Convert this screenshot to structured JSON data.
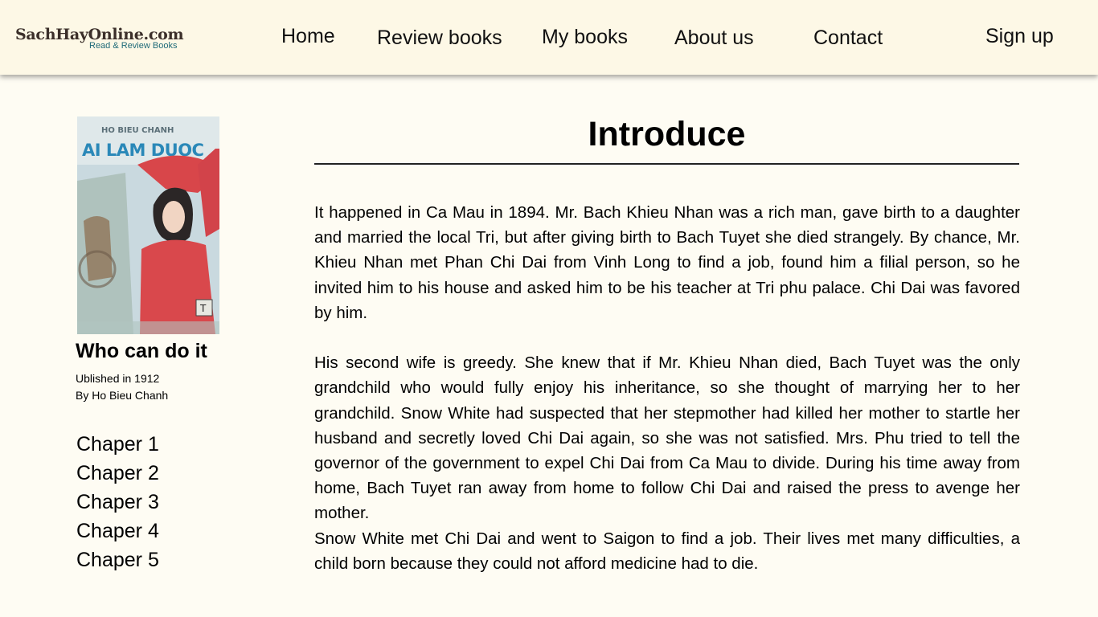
{
  "header": {
    "logo_main": "SachHayOnline.com",
    "logo_sub": "Read & Review Books",
    "nav": {
      "home": "Home",
      "review_books": "Review books",
      "my_books": "My books",
      "about_us": "About us",
      "contact": "Contact",
      "sign_up": "Sign up"
    }
  },
  "book": {
    "cover_title": "AI LAM DUOC",
    "cover_author": "HO BIEU CHANH",
    "title": "Who can do it",
    "published": "Ublished in 1912",
    "author": "By Ho Bieu Chanh",
    "chapters": [
      "Chaper 1",
      "Chaper 2",
      "Chaper 3",
      "Chaper 4",
      "Chaper 5"
    ]
  },
  "intro": {
    "heading": "Introduce",
    "paragraphs": [
      "It happened in Ca Mau in 1894. Mr. Bach Khieu Nhan was a rich man, gave birth to a daughter and married the local Tri, but after giving birth to Bach Tuyet she died strangely. By chance, Mr. Khieu Nhan met Phan Chi Dai from Vinh Long to find a job, found him a filial person, so he invited him to his house and asked him to be his teacher at Tri phu palace. Chi Dai was favored by him.",
      "His second wife is greedy. She knew that if Mr. Khieu Nhan died, Bach Tuyet was the only grandchild who would fully enjoy his inheritance, so she thought of marrying her to her grandchild. Snow White had suspected that her stepmother had killed her mother to startle her husband and secretly loved Chi Dai again, so she was not satisfied. Mrs. Phu tried to tell the governor of the government to expel Chi Dai from Ca Mau to divide. During his time away from home, Bach Tuyet ran away from home to follow Chi Dai and raised the press to avenge her mother.",
      "Snow White met Chi Dai and went to Saigon to find a job. Their lives met many difficulties, a child born because they could not afford medicine had to die."
    ]
  },
  "colors": {
    "header_bg": "#fdf8e6",
    "page_bg": "#fefcf3",
    "logo_brown": "#3b2f2a",
    "logo_teal": "#1f6a78"
  }
}
